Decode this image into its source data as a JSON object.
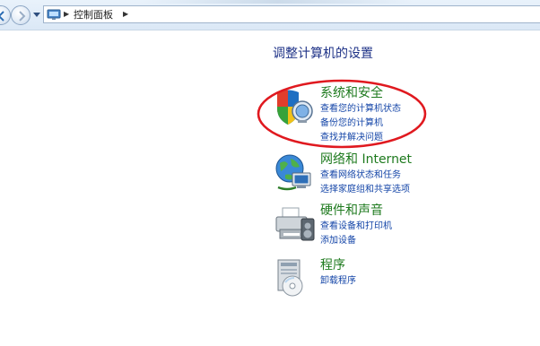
{
  "address_bar": {
    "breadcrumb": "控制面板"
  },
  "page": {
    "title": "调整计算机的设置"
  },
  "categories": [
    {
      "title": "系统和安全",
      "icon": "shield-monitor-icon",
      "links": [
        "查看您的计算机状态",
        "备份您的计算机",
        "查找并解决问题"
      ]
    },
    {
      "title": "网络和 Internet",
      "icon": "globe-network-icon",
      "links": [
        "查看网络状态和任务",
        "选择家庭组和共享选项"
      ]
    },
    {
      "title": "硬件和声音",
      "icon": "printer-hardware-icon",
      "links": [
        "查看设备和打印机",
        "添加设备"
      ]
    },
    {
      "title": "程序",
      "icon": "programs-icon",
      "links": [
        "卸载程序"
      ]
    }
  ],
  "annotation": {
    "shape": "red-ellipse",
    "color": "#e0191f"
  },
  "colors": {
    "title": "#1e3287",
    "category": "#1e7a1e",
    "link": "#1546a8"
  }
}
